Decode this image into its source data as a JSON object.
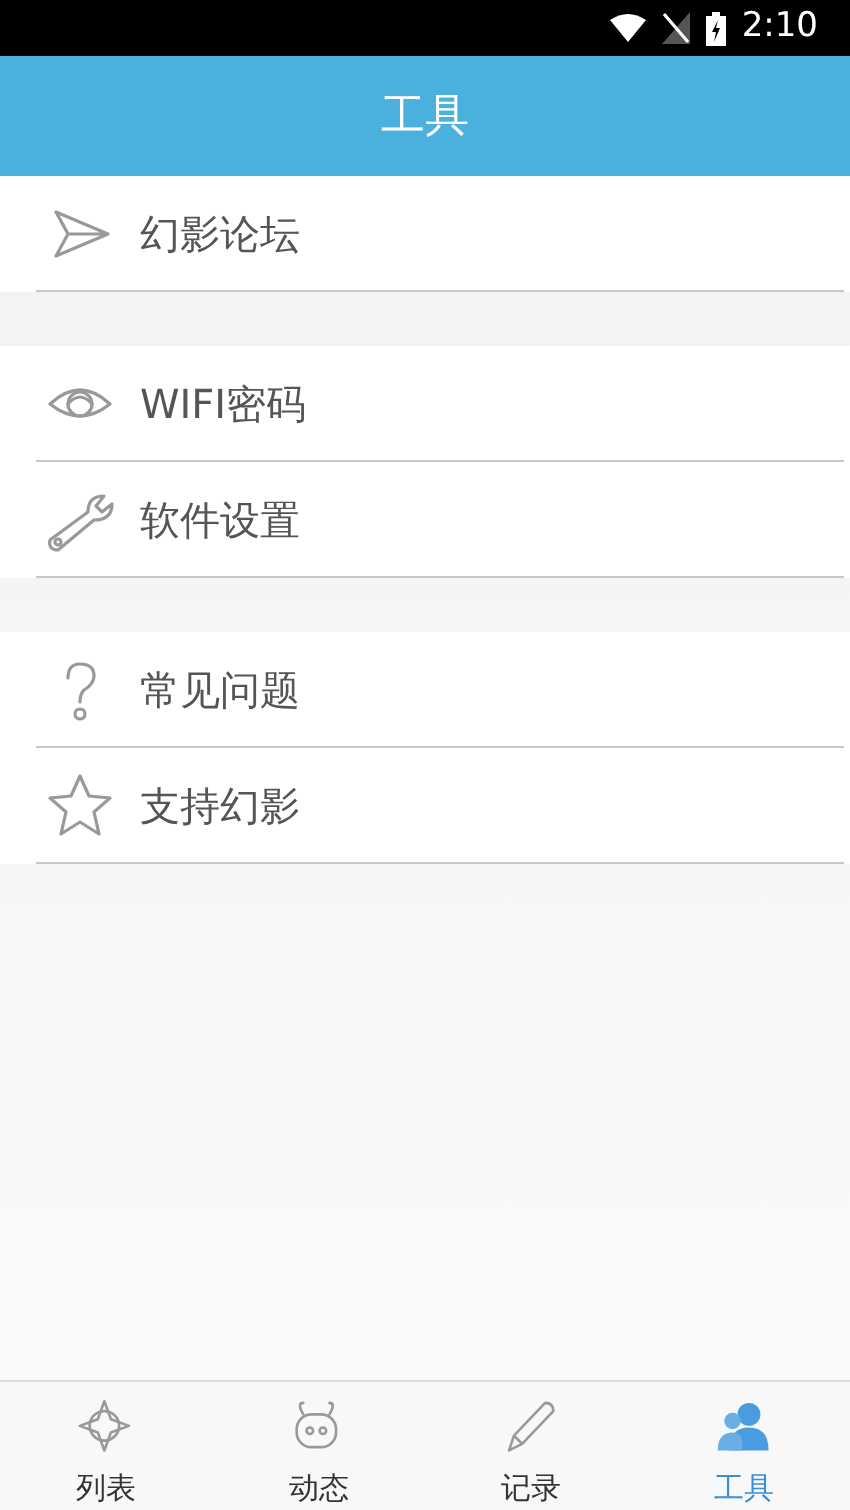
{
  "status_bar": {
    "time": "2:10"
  },
  "header": {
    "title": "工具"
  },
  "groups": [
    {
      "items": [
        {
          "label": "幻影论坛"
        }
      ]
    },
    {
      "items": [
        {
          "label": "WIFI密码"
        },
        {
          "label": "软件设置"
        }
      ]
    },
    {
      "items": [
        {
          "label": "常见问题"
        },
        {
          "label": "支持幻影"
        }
      ]
    }
  ],
  "bottom_nav": [
    {
      "label": "列表",
      "selected": false
    },
    {
      "label": "动态",
      "selected": false
    },
    {
      "label": "记录",
      "selected": false
    },
    {
      "label": "工具",
      "selected": true
    }
  ]
}
